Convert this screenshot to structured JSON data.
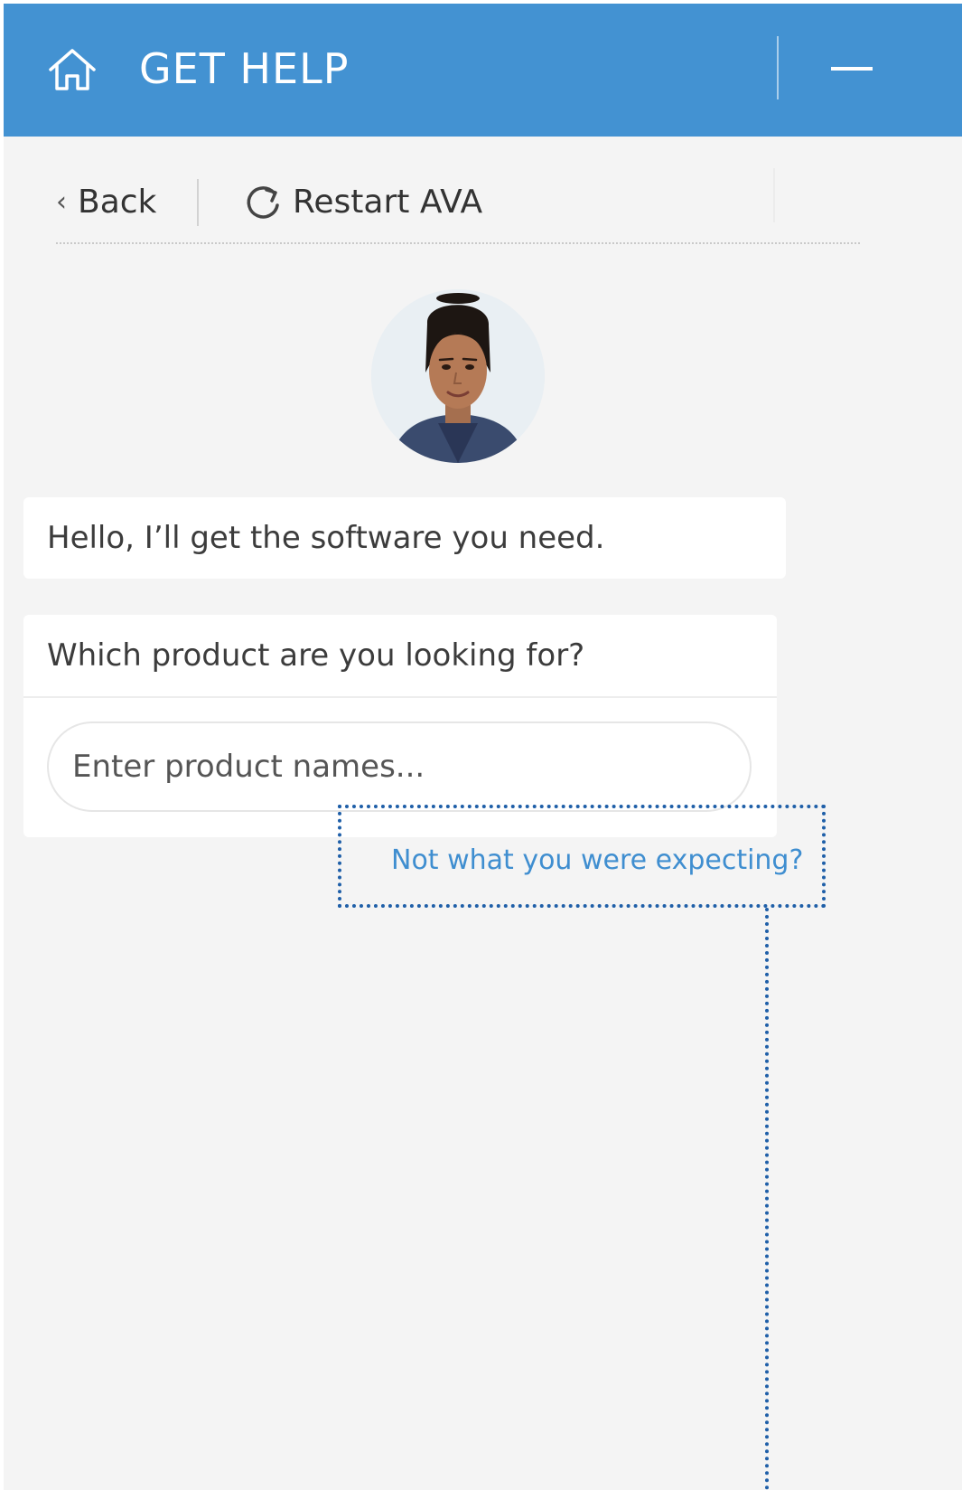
{
  "header": {
    "title": "GET HELP",
    "home_icon": "home-icon",
    "minimize_icon": "minimize-icon",
    "background_color": "#4392d2"
  },
  "toolbar": {
    "back_label": "Back",
    "back_icon": "chevron-left-icon",
    "restart_label": "Restart AVA",
    "restart_icon": "refresh-icon"
  },
  "assistant": {
    "avatar_icon": "assistant-avatar"
  },
  "conversation": {
    "greeting": "Hello, I’ll get the software you need.",
    "question": "Which product are you looking for?",
    "input_placeholder": "Enter product names...",
    "input_value": ""
  },
  "links": {
    "not_expecting": "Not what you were expecting?",
    "link_color": "#3f8ed0"
  },
  "annotation": {
    "highlight_color": "#1f5fa8"
  }
}
